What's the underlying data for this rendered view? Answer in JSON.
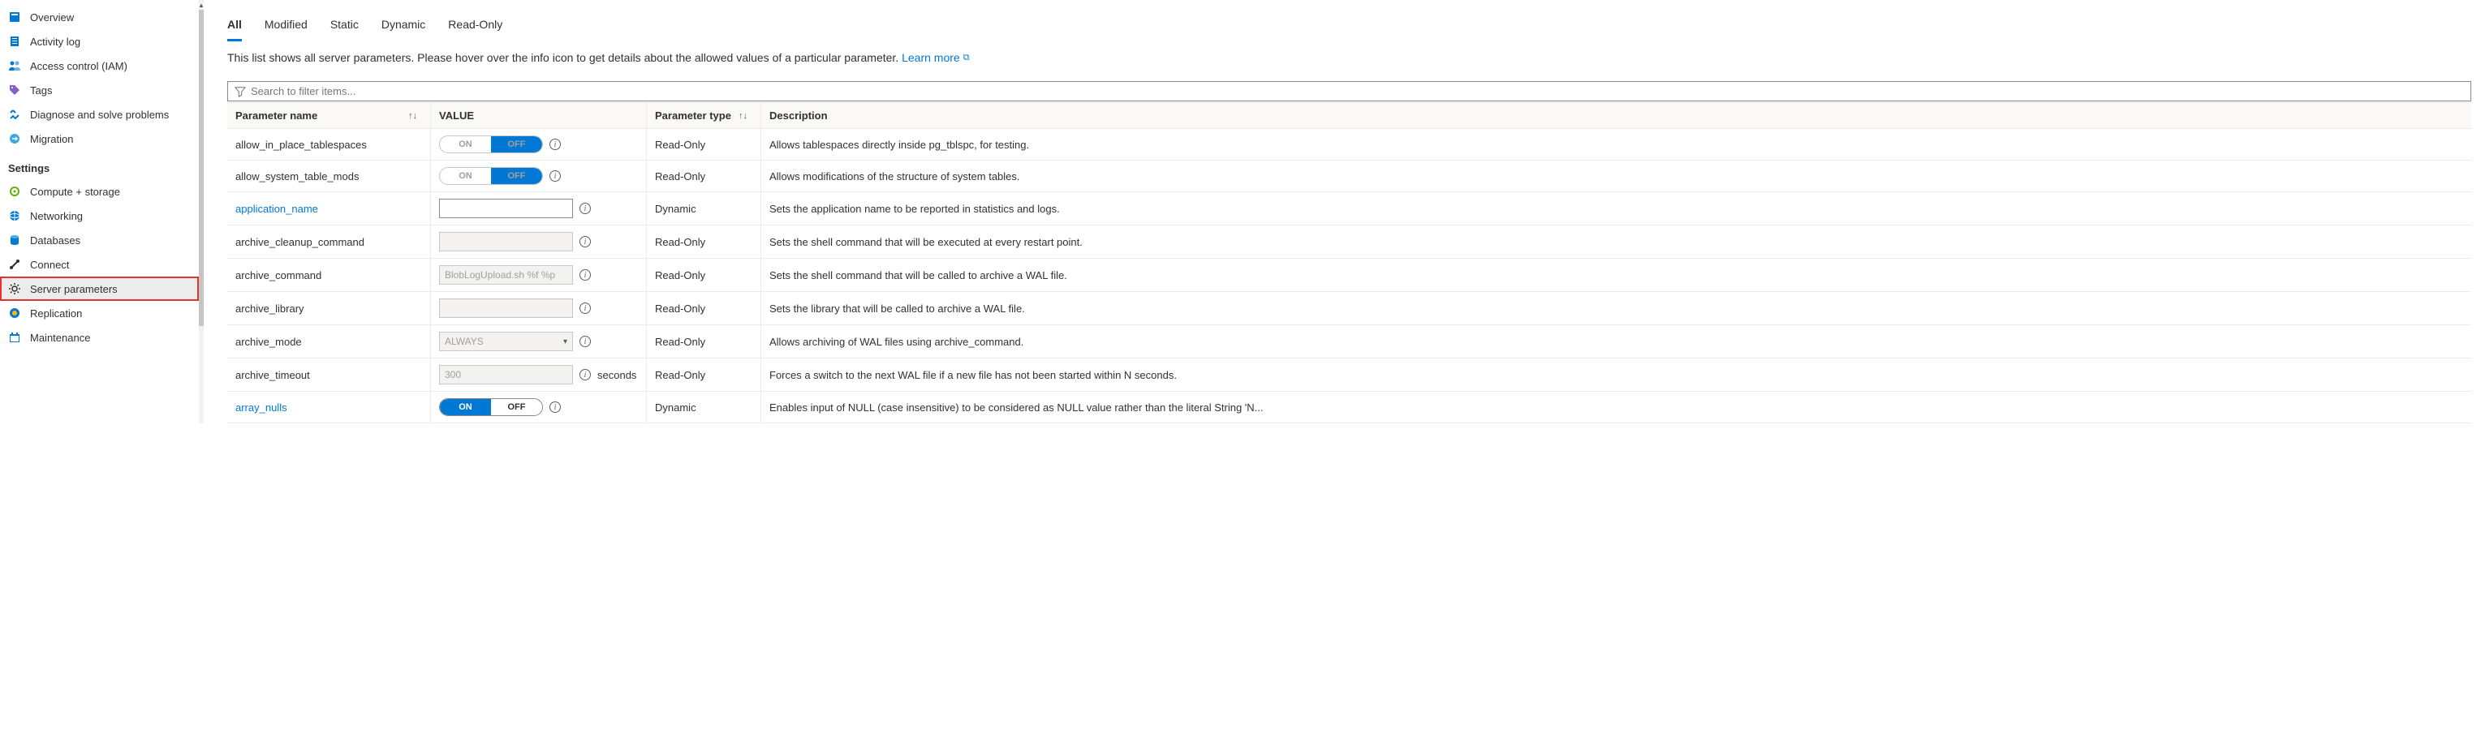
{
  "sidebar": {
    "items": [
      {
        "label": "Overview",
        "icon": "overview-icon"
      },
      {
        "label": "Activity log",
        "icon": "log-icon"
      },
      {
        "label": "Access control (IAM)",
        "icon": "iam-icon"
      },
      {
        "label": "Tags",
        "icon": "tags-icon"
      },
      {
        "label": "Diagnose and solve problems",
        "icon": "diagnose-icon"
      },
      {
        "label": "Migration",
        "icon": "migration-icon"
      }
    ],
    "settings_header": "Settings",
    "settings": [
      {
        "label": "Compute + storage",
        "icon": "compute-icon"
      },
      {
        "label": "Networking",
        "icon": "network-icon"
      },
      {
        "label": "Databases",
        "icon": "database-icon"
      },
      {
        "label": "Connect",
        "icon": "connect-icon"
      },
      {
        "label": "Server parameters",
        "icon": "gear-icon",
        "selected": true
      },
      {
        "label": "Replication",
        "icon": "replication-icon"
      },
      {
        "label": "Maintenance",
        "icon": "maintenance-icon"
      }
    ]
  },
  "tabs": [
    "All",
    "Modified",
    "Static",
    "Dynamic",
    "Read-Only"
  ],
  "active_tab": "All",
  "intro_text": "This list shows all server parameters. Please hover over the info icon to get details about the allowed values of a particular parameter. ",
  "learn_more": "Learn more",
  "search_placeholder": "Search to filter items...",
  "columns": {
    "name": "Parameter name",
    "value": "VALUE",
    "type": "Parameter type",
    "desc": "Description"
  },
  "toggle_labels": {
    "on": "ON",
    "off": "OFF"
  },
  "rows": [
    {
      "name": "allow_in_place_tablespaces",
      "control": "toggle",
      "toggle": "OFF",
      "disabled": true,
      "type": "Read-Only",
      "desc": "Allows tablespaces directly inside pg_tblspc, for testing."
    },
    {
      "name": "allow_system_table_mods",
      "control": "toggle",
      "toggle": "OFF",
      "disabled": true,
      "type": "Read-Only",
      "desc": "Allows modifications of the structure of system tables."
    },
    {
      "name": "application_name",
      "link": true,
      "control": "text",
      "value": "",
      "disabled": false,
      "type": "Dynamic",
      "desc": "Sets the application name to be reported in statistics and logs."
    },
    {
      "name": "archive_cleanup_command",
      "control": "text",
      "value": "",
      "disabled": true,
      "type": "Read-Only",
      "desc": "Sets the shell command that will be executed at every restart point."
    },
    {
      "name": "archive_command",
      "control": "text",
      "value": "BlobLogUpload.sh %f %p",
      "disabled": true,
      "type": "Read-Only",
      "desc": "Sets the shell command that will be called to archive a WAL file."
    },
    {
      "name": "archive_library",
      "control": "text",
      "value": "",
      "disabled": true,
      "type": "Read-Only",
      "desc": "Sets the library that will be called to archive a WAL file."
    },
    {
      "name": "archive_mode",
      "control": "dropdown",
      "value": "ALWAYS",
      "type": "Read-Only",
      "desc": "Allows archiving of WAL files using archive_command."
    },
    {
      "name": "archive_timeout",
      "control": "text",
      "value": "300",
      "disabled": true,
      "unit": "seconds",
      "type": "Read-Only",
      "desc": "Forces a switch to the next WAL file if a new file has not been started within N seconds."
    },
    {
      "name": "array_nulls",
      "link": true,
      "control": "toggle",
      "toggle": "ON",
      "disabled": false,
      "type": "Dynamic",
      "desc": "Enables input of NULL (case insensitive) to be considered as NULL value rather than the literal String 'N..."
    }
  ]
}
